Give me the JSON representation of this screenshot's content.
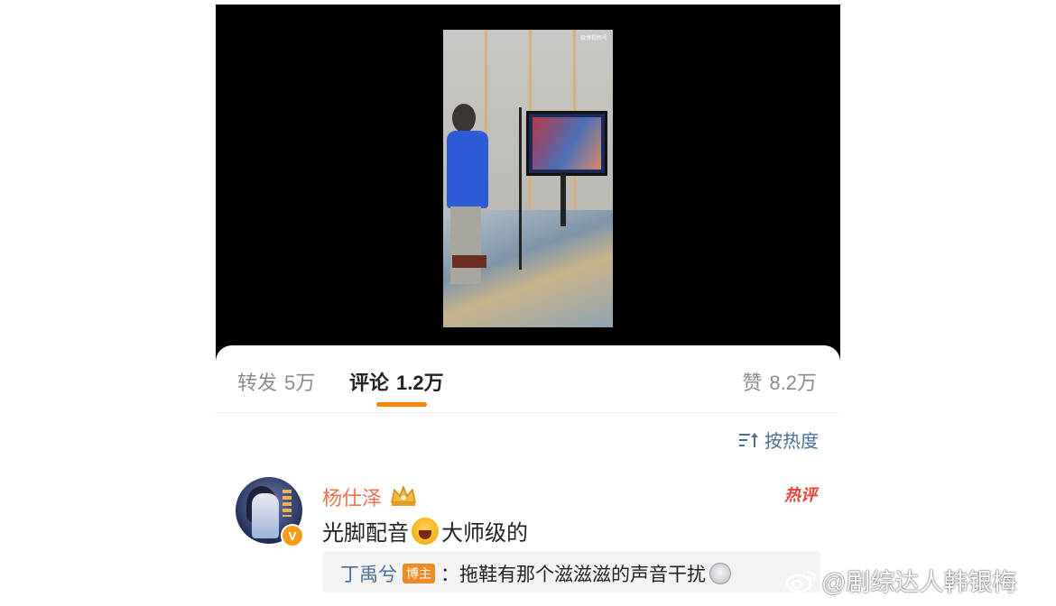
{
  "video": {
    "watermark": "微博视频号"
  },
  "tabs": [
    {
      "label": "转发",
      "count": "5万"
    },
    {
      "label": "评论",
      "count": "1.2万"
    },
    {
      "label": "赞",
      "count": "8.2万"
    }
  ],
  "active_tab": "评论",
  "sort": {
    "label": "按热度",
    "icon": "sort-icon"
  },
  "comment": {
    "username": "杨仕泽",
    "hot_label": "热评",
    "text_before": "光脚配音",
    "text_after": "大师级的",
    "emoji": "laughing-emoji",
    "reply": {
      "user": "丁禹兮",
      "badge": "博主",
      "text": "：拖鞋有那个滋滋滋的声音干扰",
      "emoji": "dizzy-emoji"
    }
  },
  "watermark": {
    "text": "@剧综达人韩银梅",
    "icon": "weibo-icon"
  },
  "colors": {
    "accent": "#ff8200",
    "username": "#eb7350",
    "link": "#4a6d99",
    "hot": "#e8443a"
  }
}
